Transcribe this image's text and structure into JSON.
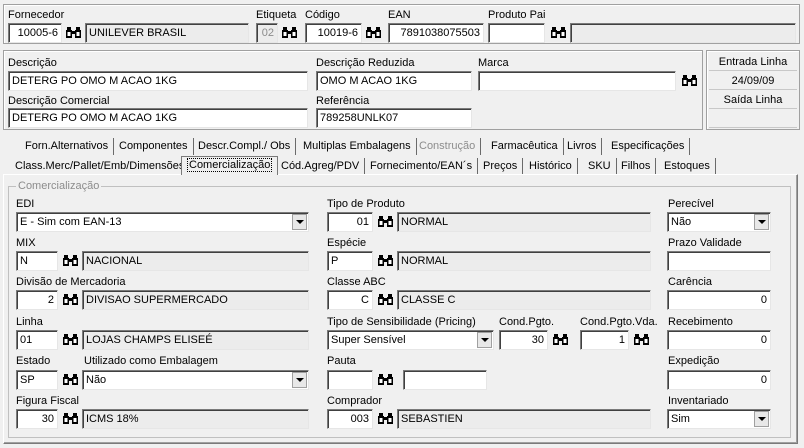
{
  "top": {
    "fornecedor_label": "Fornecedor",
    "fornecedor_code": "10005-6",
    "fornecedor_name": "UNILEVER BRASIL",
    "etiqueta_label": "Etiqueta",
    "etiqueta_value": "02",
    "codigo_label": "Código",
    "codigo_value": "10019-6",
    "ean_label": "EAN",
    "ean_value": "7891038075503",
    "produto_pai_label": "Produto Pai",
    "produto_pai_value": "",
    "produto_pai_desc": ""
  },
  "desc": {
    "descricao_label": "Descrição",
    "descricao_value": "DETERG PO OMO M ACAO 1KG",
    "descricao_reduzida_label": "Descrição Reduzida",
    "descricao_reduzida_value": "OMO M ACAO 1KG",
    "marca_label": "Marca",
    "marca_value": "",
    "descricao_comercial_label": "Descrição Comercial",
    "descricao_comercial_value": "DETERG PO OMO M ACAO 1KG",
    "referencia_label": "Referência",
    "referencia_value": "789258UNLK07"
  },
  "side": {
    "entrada_label": "Entrada Linha",
    "entrada_date": "24/09/09",
    "saida_label": "Saída Linha",
    "saida_date": ""
  },
  "tabs_row1": [
    {
      "label": "Forn.Alternativos"
    },
    {
      "label": "Componentes"
    },
    {
      "label": "Descr.Compl./ Obs"
    },
    {
      "label": "Multiplas Embalagens"
    },
    {
      "label": "Construção"
    },
    {
      "label": "Farmacêutica"
    },
    {
      "label": "Livros"
    },
    {
      "label": "Especificações"
    }
  ],
  "tabs_row2": [
    {
      "label": "Class.Merc/Pallet/Emb/Dimensões"
    },
    {
      "label": "Comercialização"
    },
    {
      "label": "Cód.Agreg/PDV"
    },
    {
      "label": "Fornecimento/EAN´s"
    },
    {
      "label": "Preços"
    },
    {
      "label": "Histórico"
    },
    {
      "label": "SKU"
    },
    {
      "label": "Filhos"
    },
    {
      "label": "Estoques"
    }
  ],
  "group_title": "Comercialização",
  "fields": {
    "edi_label": "EDI",
    "edi_value": "E - Sim com EAN-13",
    "mix_label": "MIX",
    "mix_code": "N",
    "mix_desc": "NACIONAL",
    "divisao_label": "Divisão de Mercadoria",
    "divisao_code": "2",
    "divisao_desc": "DIVISAO SUPERMERCADO",
    "linha_label": "Linha",
    "linha_code": "01",
    "linha_desc": "LOJAS CHAMPS ELISEÉ",
    "estado_label": "Estado",
    "estado_code": "SP",
    "utilizado_label": "Utilizado como Embalagem",
    "utilizado_value": "Não",
    "figura_label": "Figura Fiscal",
    "figura_code": "30",
    "figura_desc": "ICMS 18%",
    "tipo_produto_label": "Tipo de Produto",
    "tipo_produto_code": "01",
    "tipo_produto_desc": "NORMAL",
    "especie_label": "Espécie",
    "especie_code": "P",
    "especie_desc": "NORMAL",
    "classe_label": "Classe ABC",
    "classe_code": "C",
    "classe_desc": "CLASSE C",
    "sensib_label": "Tipo de Sensibilidade (Pricing)",
    "sensib_value": "Super Sensível",
    "cond_pgto_label": "Cond.Pgto.",
    "cond_pgto_value": "30",
    "cond_pgto_vda_label": "Cond.Pgto.Vda.",
    "cond_pgto_vda_value": "1",
    "pauta_label": "Pauta",
    "pauta_code": "",
    "pauta_desc": "",
    "comprador_label": "Comprador",
    "comprador_code": "003",
    "comprador_desc": "SEBASTIEN",
    "perecivel_label": "Perecível",
    "perecivel_value": "Não",
    "prazo_label": "Prazo Validade",
    "prazo_value": "",
    "carencia_label": "Carência",
    "carencia_value": "0",
    "recebimento_label": "Recebimento",
    "recebimento_value": "0",
    "expedicao_label": "Expedição",
    "expedicao_value": "0",
    "inventariado_label": "Inventariado",
    "inventariado_value": "Sim"
  },
  "icons": {
    "lookup": "binoculars-icon",
    "dropdown": "chevron-down-icon"
  }
}
